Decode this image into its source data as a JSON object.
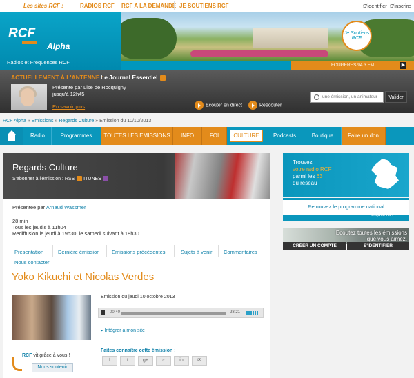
{
  "topbar": {
    "sites_label": "Les sites RCF :",
    "links": [
      "RADIOS RCF",
      "RCF A LA DEMANDE",
      "JE SOUTIENS RCF"
    ],
    "identify": "S'identifier",
    "register": "S'inscrire"
  },
  "header": {
    "logo": "RCF",
    "logo_sub": "Alpha",
    "tagline": "Radios et Fréquences RCF",
    "badge": "Je Soutiens RCF",
    "photo_caption": "FOUGERES 94.3 FM"
  },
  "antenne": {
    "label": "ACTUELLEMENT À L'ANTENNE :",
    "show": "Le Journal Essentiel",
    "presenter": "Présenté par Lise de Rocquigny",
    "until": "jusqu'à 12h45",
    "more": "En savoir plus",
    "live": "Ecouter en direct",
    "replay": "Réécouter",
    "search_placeholder": "une émission, un animateur",
    "validate": "Valider"
  },
  "breadcrumb": {
    "items": [
      "RCF Alpha",
      "Emissions",
      "Regards Culture"
    ],
    "current": "Emission du 10/10/2013"
  },
  "nav": {
    "items": [
      "Radio",
      "Programmes",
      "TOUTES LES EMISSIONS",
      "INFO",
      "FOI",
      "CULTURE",
      "Podcasts",
      "Boutique",
      "Faire un don"
    ]
  },
  "emission": {
    "title": "Regards Culture",
    "subscribe": "S'abonner à l'émission : RSS",
    "itunes": "ITUNES",
    "presented_by": "Présentée par",
    "host": "Arnaud Wassmer",
    "duration": "28 min",
    "schedule": "Tous les jeudis à 11h04",
    "rerun": "Rediffusion le jeudi à 19h30, le samedi suivant à 18h30"
  },
  "tabs": [
    "Présentation",
    "Dernière émission",
    "Emissions précédentes",
    "Sujets à venir",
    "Commentaires",
    "Nous contacter"
  ],
  "episode": {
    "title": "Yoko Kikuchi et Nicolas Verdes",
    "date": "Emission du jeudi 10 octobre 2013",
    "time_elapsed": "00:40",
    "time_total": "28:21",
    "embed": "Intégrer à mon site",
    "share_label": "Faites connaître cette émission :",
    "share_icons": [
      "f",
      "t",
      "g+",
      "♂",
      "in",
      "✉"
    ]
  },
  "support": {
    "brand": "RCF",
    "text": "vit grâce à vous !",
    "button": "Nous soutenir"
  },
  "sidebar": {
    "find_line1": "Trouvez",
    "find_line2": "votre radio RCF",
    "find_line3_a": "parmi les",
    "find_count": "63",
    "find_line4": "du réseau",
    "national": "Retrouvez le programme national",
    "click": "cliquez ici >>",
    "listen_line1": "Ecoutez toutes les émissions",
    "listen_line2": "que vous aimez.",
    "create_account": "CRÉER UN COMPTE",
    "identify": "S'IDENTIFIER"
  },
  "colors": {
    "accent": "#e38b1b",
    "brand": "#0a97bc",
    "dark": "#333333"
  }
}
